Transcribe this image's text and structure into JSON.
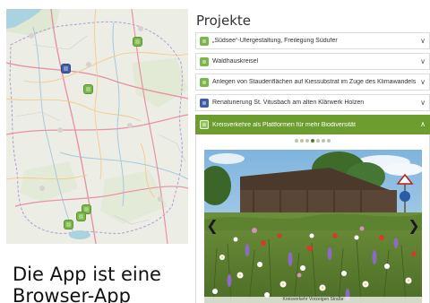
{
  "caption": {
    "line1": "Die App ist eine",
    "line2": "Browser-App"
  },
  "panel": {
    "title": "Projekte",
    "items": [
      {
        "label": "„Südsee“-Ufergestaltung, Freilegung Südufer",
        "icon": "leaf-marker-icon",
        "color": "#7ab648"
      },
      {
        "label": "Waldhauskreisel",
        "icon": "leaf-marker-icon",
        "color": "#7ab648"
      },
      {
        "label": "Anlegen von Staudenflächen auf Kiessubstrat im Zuge des Klimawandels",
        "icon": "leaf-marker-icon",
        "color": "#7ab648"
      },
      {
        "label": "Renaturierung St. Vitusbach am alten Klärwerk Holzen",
        "icon": "water-marker-icon",
        "color": "#3e5ea8"
      },
      {
        "label": "Kreisverkehre als Plattformen für mehr Biodiversität",
        "icon": "leaf-marker-icon",
        "color": "#6d9d2f",
        "expanded": true
      }
    ],
    "carousel": {
      "slide_count": 7,
      "active_index": 3,
      "photo_caption": "Kreisverkehr Vorzeigen Straße"
    }
  },
  "map": {
    "markers": [
      {
        "type": "green",
        "icon": "leaf-marker-icon"
      },
      {
        "type": "blue",
        "icon": "water-marker-icon"
      },
      {
        "type": "green",
        "icon": "leaf-marker-icon"
      },
      {
        "type": "green",
        "icon": "leaf-marker-icon"
      },
      {
        "type": "green",
        "icon": "leaf-marker-icon"
      },
      {
        "type": "green",
        "icon": "leaf-marker-icon"
      }
    ]
  },
  "colors": {
    "accent_green": "#6d9d2f",
    "marker_green": "#7ab648",
    "marker_blue": "#3e5ea8"
  }
}
